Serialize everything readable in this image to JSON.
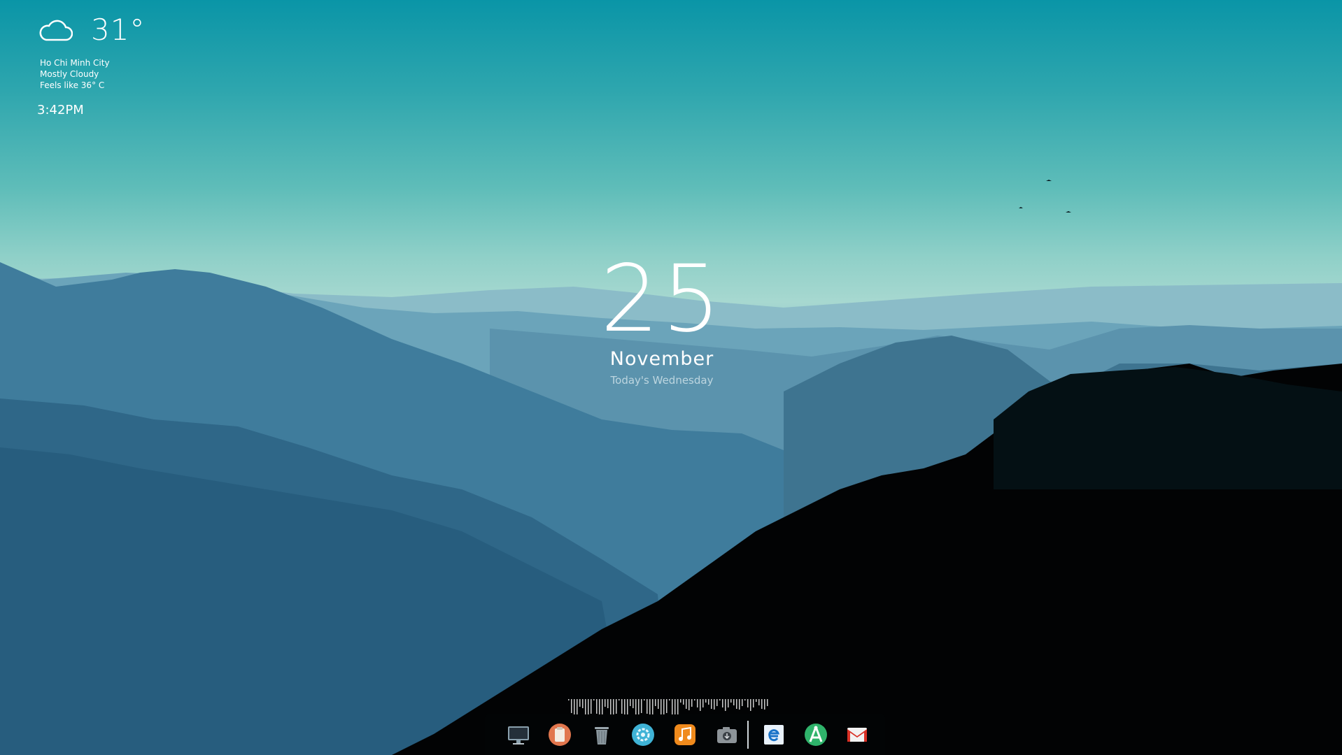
{
  "weather": {
    "temperature": "31°",
    "city": "Ho Chi Minh City",
    "condition": "Mostly Cloudy",
    "feels_like": "Feels like 36° C",
    "icon": "cloud-icon"
  },
  "clock": {
    "time": "3:42PM"
  },
  "date": {
    "day": "25",
    "month": "November",
    "weekday": "Today's Wednesday"
  },
  "dock": {
    "items": [
      {
        "icon": "monitor-icon"
      },
      {
        "icon": "clipboard-icon"
      },
      {
        "icon": "trash-icon"
      },
      {
        "icon": "settings-gear-icon"
      },
      {
        "icon": "music-icon"
      },
      {
        "icon": "camera-download-icon"
      },
      {
        "icon": "internet-explorer-icon"
      },
      {
        "icon": "app-launcher-icon"
      },
      {
        "icon": "gmail-icon"
      }
    ]
  },
  "colors": {
    "sky_top": "#0a95a7",
    "haze": "#a7d8d0",
    "forest_dark": "#020405",
    "dock_bg": "#020405"
  }
}
